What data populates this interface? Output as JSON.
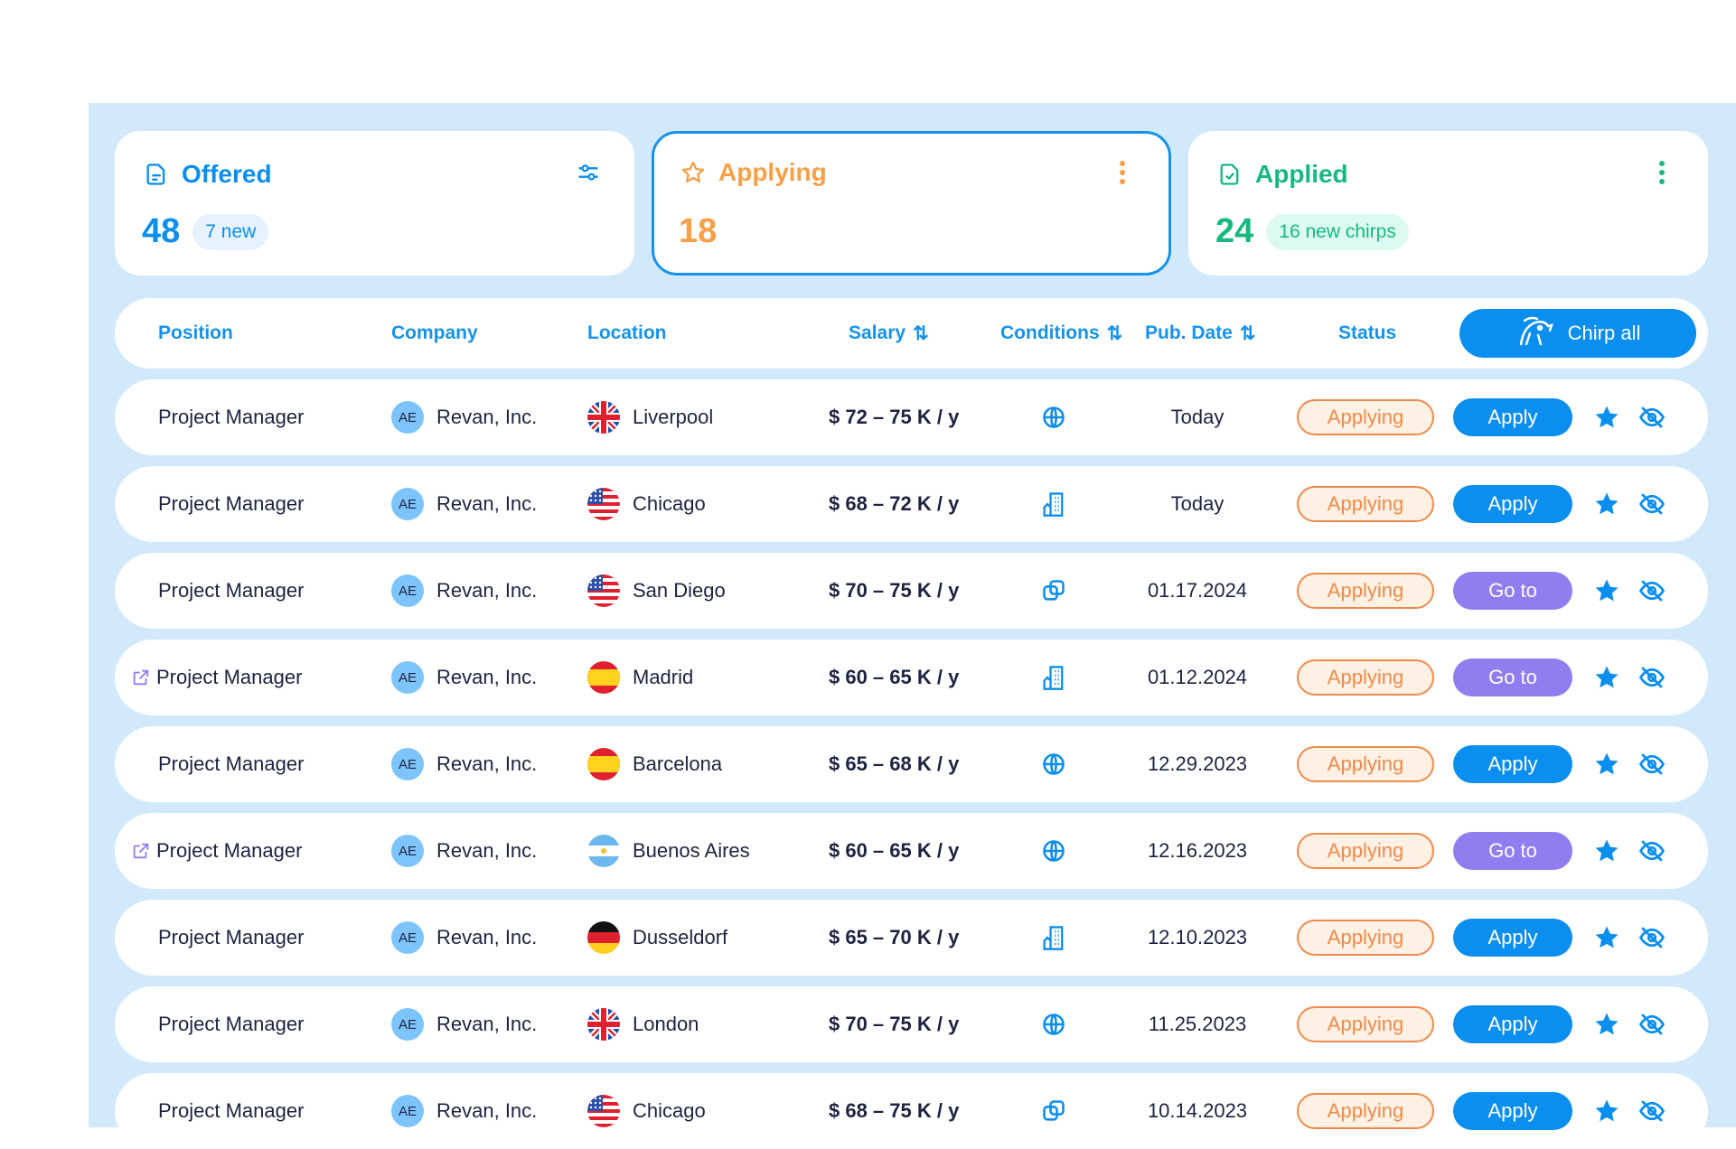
{
  "colors": {
    "primary": "#0a8ef0",
    "orange": "#f7a046",
    "green": "#16b97e",
    "purple": "#8f7ef0",
    "status_border": "#f08a4b"
  },
  "cards": [
    {
      "title": "Offered",
      "count": "48",
      "badge": "7 new",
      "icon": "document-icon",
      "menu_icon": "sliders-icon"
    },
    {
      "title": "Applying",
      "count": "18",
      "badge": "",
      "icon": "star-outline-icon",
      "menu_icon": "more-vertical-icon"
    },
    {
      "title": "Applied",
      "count": "24",
      "badge": "16 new chirps",
      "icon": "document-check-icon",
      "menu_icon": "more-vertical-icon"
    }
  ],
  "table": {
    "headers": {
      "position": "Position",
      "company": "Company",
      "location": "Location",
      "salary": "Salary",
      "conditions": "Conditions",
      "pub_date": "Pub. Date",
      "status": "Status",
      "sort_glyph": "⇅"
    },
    "chirp_all": "Chirp all",
    "rows": [
      {
        "position": "Project Manager",
        "external": false,
        "avatar": "AE",
        "company": "Revan, Inc.",
        "flag": "uk",
        "location": "Liverpool",
        "salary": "$ 72 – 75 K / y",
        "condition": "globe",
        "date": "Today",
        "status": "Applying",
        "action": "Apply",
        "action_type": "apply"
      },
      {
        "position": "Project Manager",
        "external": false,
        "avatar": "AE",
        "company": "Revan, Inc.",
        "flag": "us",
        "location": "Chicago",
        "salary": "$ 68 – 72 K / y",
        "condition": "building",
        "date": "Today",
        "status": "Applying",
        "action": "Apply",
        "action_type": "apply"
      },
      {
        "position": "Project Manager",
        "external": false,
        "avatar": "AE",
        "company": "Revan, Inc.",
        "flag": "us",
        "location": "San Diego",
        "salary": "$ 70 – 75 K / y",
        "condition": "hybrid",
        "date": "01.17.2024",
        "status": "Applying",
        "action": "Go to",
        "action_type": "goto"
      },
      {
        "position": "Project Manager",
        "external": true,
        "avatar": "AE",
        "company": "Revan, Inc.",
        "flag": "es",
        "location": "Madrid",
        "salary": "$ 60 – 65 K / y",
        "condition": "building",
        "date": "01.12.2024",
        "status": "Applying",
        "action": "Go to",
        "action_type": "goto"
      },
      {
        "position": "Project Manager",
        "external": false,
        "avatar": "AE",
        "company": "Revan, Inc.",
        "flag": "es",
        "location": "Barcelona",
        "salary": "$ 65 – 68 K / y",
        "condition": "globe",
        "date": "12.29.2023",
        "status": "Applying",
        "action": "Apply",
        "action_type": "apply"
      },
      {
        "position": "Project Manager",
        "external": true,
        "avatar": "AE",
        "company": "Revan, Inc.",
        "flag": "ar",
        "location": "Buenos Aires",
        "salary": "$ 60 – 65 K / y",
        "condition": "globe",
        "date": "12.16.2023",
        "status": "Applying",
        "action": "Go to",
        "action_type": "goto"
      },
      {
        "position": "Project Manager",
        "external": false,
        "avatar": "AE",
        "company": "Revan, Inc.",
        "flag": "de",
        "location": "Dusseldorf",
        "salary": "$ 65 – 70 K / y",
        "condition": "building",
        "date": "12.10.2023",
        "status": "Applying",
        "action": "Apply",
        "action_type": "apply"
      },
      {
        "position": "Project Manager",
        "external": false,
        "avatar": "AE",
        "company": "Revan, Inc.",
        "flag": "uk",
        "location": "London",
        "salary": "$ 70 – 75 K / y",
        "condition": "globe",
        "date": "11.25.2023",
        "status": "Applying",
        "action": "Apply",
        "action_type": "apply"
      },
      {
        "position": "Project Manager",
        "external": false,
        "avatar": "AE",
        "company": "Revan, Inc.",
        "flag": "us",
        "location": "Chicago",
        "salary": "$ 68 – 75 K / y",
        "condition": "hybrid",
        "date": "10.14.2023",
        "status": "Applying",
        "action": "Apply",
        "action_type": "apply"
      }
    ]
  }
}
